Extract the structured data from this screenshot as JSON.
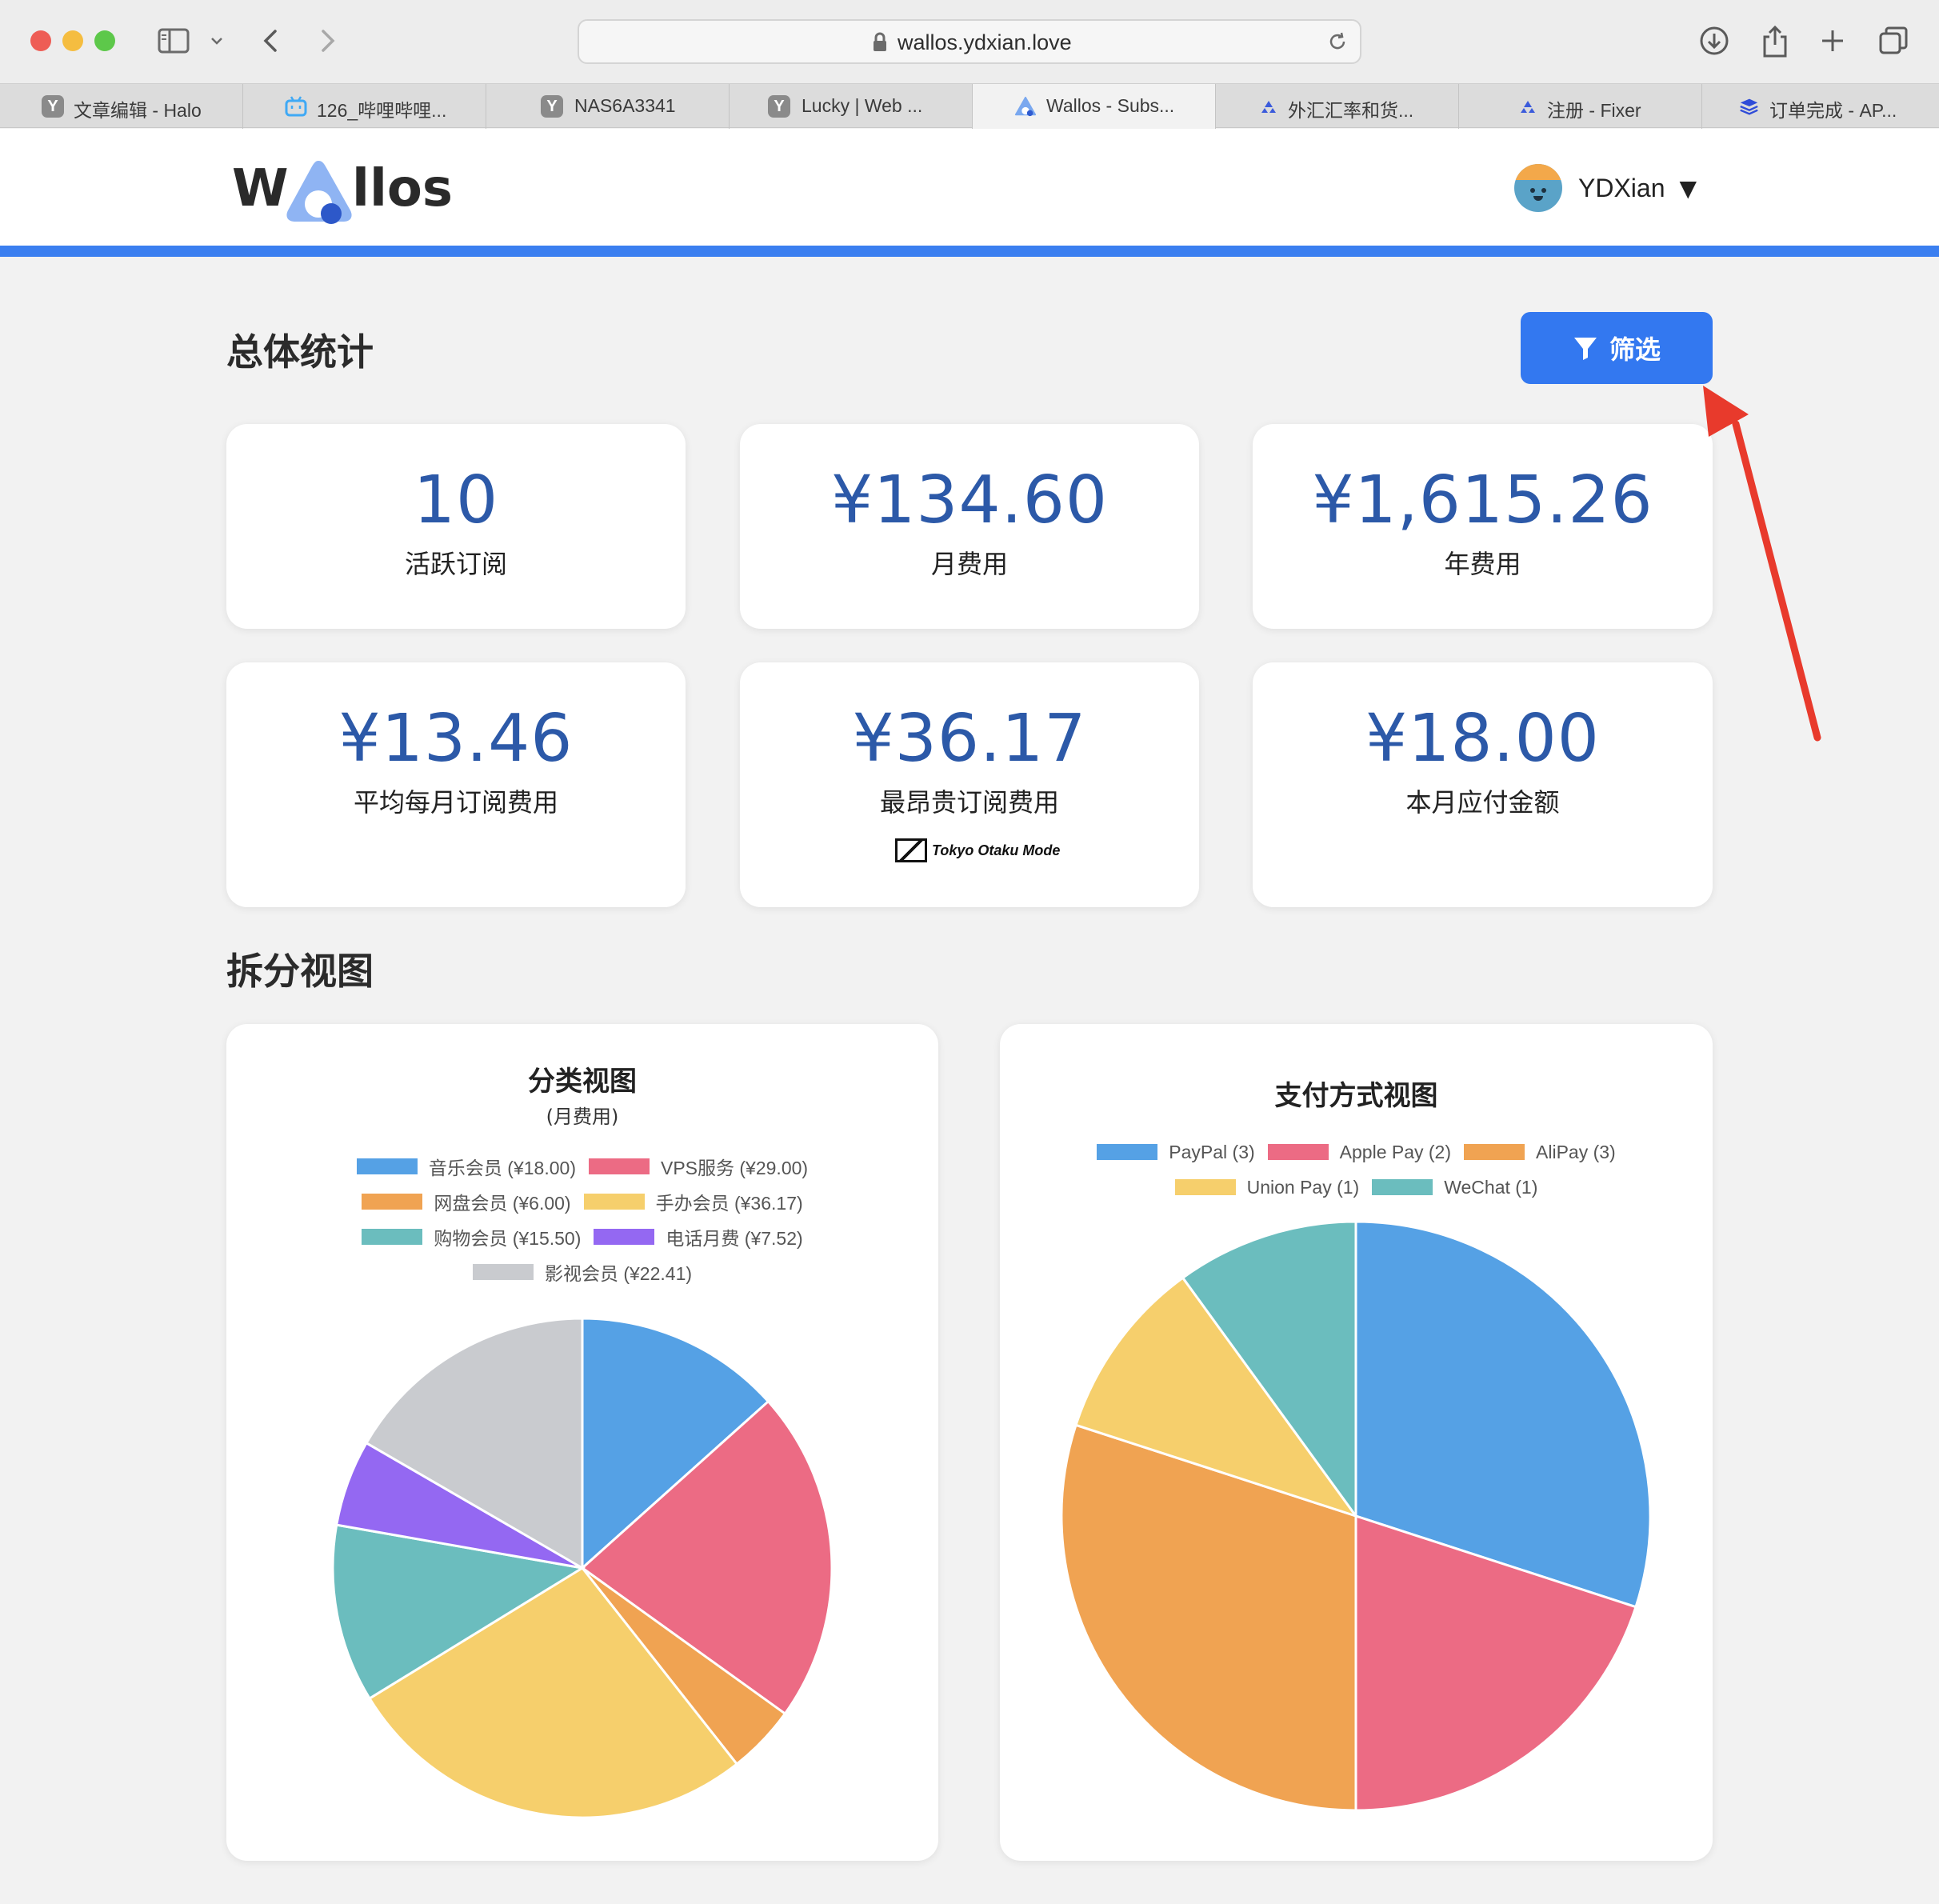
{
  "browser": {
    "url": "wallos.ydxian.love",
    "tabs": [
      {
        "label": "文章编辑 - Halo",
        "icon": "y-icon",
        "fav": "Y",
        "color": "#8a8a8a"
      },
      {
        "label": "126_哔哩哔哩...",
        "icon": "bilibili-icon",
        "fav": "",
        "color": "#3fa9f5"
      },
      {
        "label": "NAS6A3341",
        "icon": "y-icon",
        "fav": "Y",
        "color": "#8a8a8a"
      },
      {
        "label": "Lucky | Web ...",
        "icon": "y-icon",
        "fav": "Y",
        "color": "#8a8a8a"
      },
      {
        "label": "Wallos - Subs...",
        "icon": "wallos-icon",
        "fav": "",
        "color": "#7aa8ef"
      },
      {
        "label": "外汇汇率和货...",
        "icon": "fixer-icon",
        "fav": "",
        "color": "#3b5bdb"
      },
      {
        "label": "注册 - Fixer",
        "icon": "fixer-icon",
        "fav": "",
        "color": "#3b5bdb"
      },
      {
        "label": "订单完成 - AP...",
        "icon": "apilayer-icon",
        "fav": "",
        "color": "#2f4cd8"
      }
    ]
  },
  "header": {
    "logo_left": "W",
    "logo_right": "llos",
    "username": "YDXian",
    "caret": "▼",
    "accent": "#3b7ff0"
  },
  "overview": {
    "title": "总体统计",
    "filter_label": "筛选",
    "stats": [
      {
        "value": "10",
        "label": "活跃订阅"
      },
      {
        "value": "¥134.60",
        "label": "月费用"
      },
      {
        "value": "¥1,615.26",
        "label": "年费用"
      },
      {
        "value": "¥13.46",
        "label": "平均每月订阅费用"
      },
      {
        "value": "¥36.17",
        "label": "最昂贵订阅费用",
        "logo_text": "Tokyo Otaku Mode"
      },
      {
        "value": "¥18.00",
        "label": "本月应付金额"
      }
    ]
  },
  "breakdown": {
    "title": "拆分视图"
  },
  "chart_data": [
    {
      "type": "pie",
      "title": "分类视图",
      "subtitle": "(月费用)",
      "categories": [
        "音乐会员 (¥18.00)",
        "VPS服务 (¥29.00)",
        "网盘会员 (¥6.00)",
        "手办会员 (¥36.17)",
        "购物会员 (¥15.50)",
        "电话月费 (¥7.52)",
        "影视会员 (¥22.41)"
      ],
      "values": [
        18.0,
        29.0,
        6.0,
        36.17,
        15.5,
        7.52,
        22.41
      ],
      "colors": [
        "#55a1e5",
        "#ec6b84",
        "#f0a352",
        "#f6cf6c",
        "#6bbdbe",
        "#9468f2",
        "#c9cbcf"
      ],
      "legend_rows": [
        [
          0,
          1
        ],
        [
          2,
          3
        ],
        [
          4,
          5
        ],
        [
          6
        ]
      ],
      "legend": "top"
    },
    {
      "type": "pie",
      "title": "支付方式视图",
      "categories": [
        "PayPal (3)",
        "Apple Pay (2)",
        "AliPay (3)",
        "Union Pay (1)",
        "WeChat (1)"
      ],
      "values": [
        3,
        2,
        3,
        1,
        1
      ],
      "colors": [
        "#55a1e5",
        "#ec6b84",
        "#f0a352",
        "#f6cf6c",
        "#6bbdbe"
      ],
      "legend_rows": [
        [
          0,
          1,
          2
        ],
        [
          3,
          4
        ]
      ],
      "legend": "top"
    }
  ]
}
